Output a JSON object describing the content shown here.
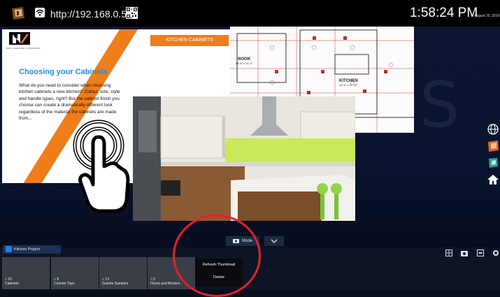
{
  "topbar": {
    "url": "http://192.168.0.53",
    "time": "1:58:24 PM",
    "date": "August 20, 2019"
  },
  "slide": {
    "header": "KITCHEN CABINETS",
    "logo_text": "NEST FURNITURE & ASSOCIATES",
    "title": "Choosing your Cabinets",
    "body": "What do you need to consider when choosing kitchen cabinets a new kitchen? Colour, size, style and handle types, right? But the cabinet finish you choose can create a dramatically different look regardless of the material the cabinets are made from..."
  },
  "floorplan": {
    "nook_label": "NOOK",
    "nook_dims": "14'-6\" x 11'-2\"",
    "kitchen_label": "KITCHEN",
    "kitchen_dims": "14'-6\" x 11'-10\""
  },
  "watermark": "S",
  "project": {
    "name": "Kitchen Project"
  },
  "mode": {
    "label": "Mode"
  },
  "thumbnails": [
    {
      "count": "10",
      "name": "Cabinets"
    },
    {
      "count": "8",
      "name": "Counter Tops"
    },
    {
      "count": "13",
      "name": "Granite Samples"
    },
    {
      "count": "5",
      "name": "Floors and Borders"
    }
  ],
  "context_menu": {
    "items": [
      "Refresh Thumbnail",
      "Delete"
    ]
  },
  "colors": {
    "accent_orange": "#ef7d1a",
    "title_blue": "#1f8fd8",
    "annotation_red": "#e8202a"
  }
}
